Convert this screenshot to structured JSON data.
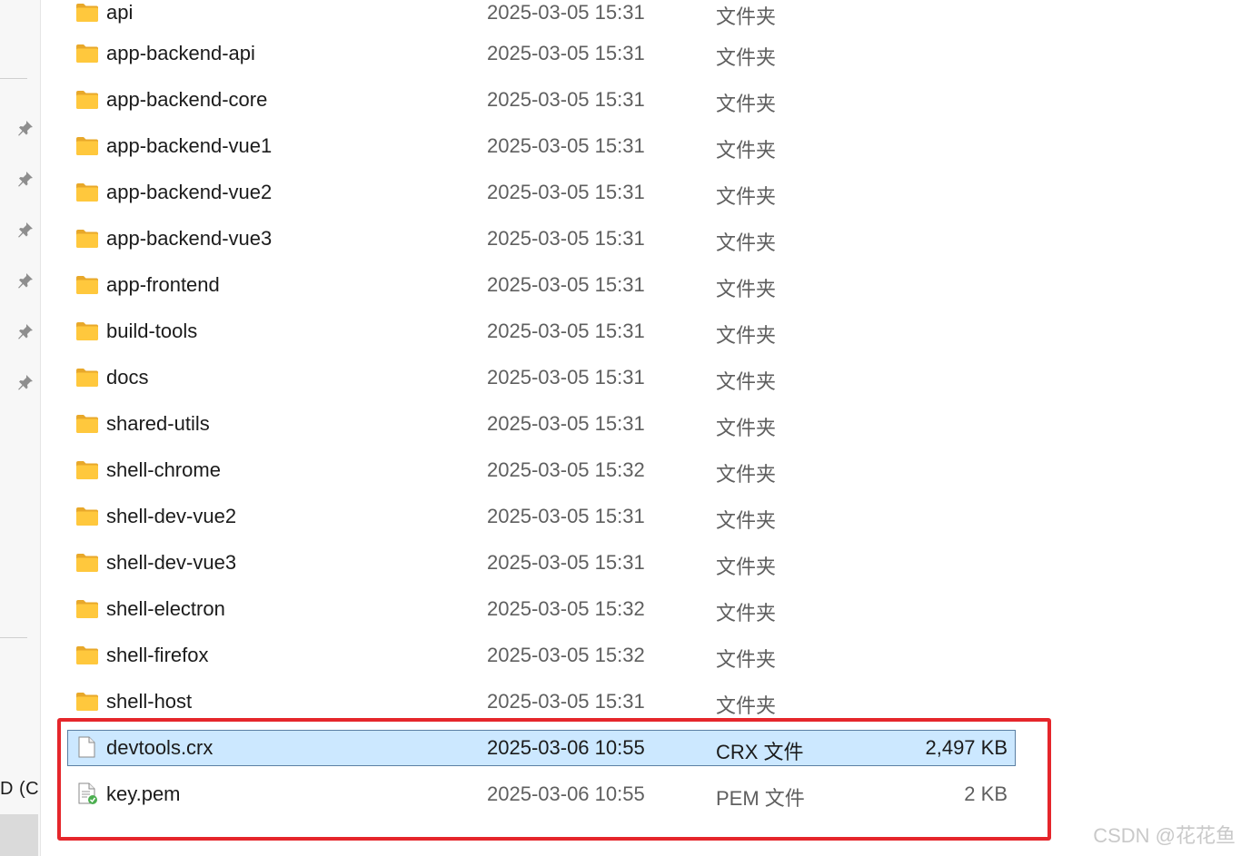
{
  "nav": {
    "partial_text": "D (C",
    "pin_count": 6
  },
  "files": [
    {
      "name": "api",
      "date": "2025-03-05 15:31",
      "type": "文件夹",
      "size": "",
      "icon": "folder-icon"
    },
    {
      "name": "app-backend-api",
      "date": "2025-03-05 15:31",
      "type": "文件夹",
      "size": "",
      "icon": "folder-icon"
    },
    {
      "name": "app-backend-core",
      "date": "2025-03-05 15:31",
      "type": "文件夹",
      "size": "",
      "icon": "folder-icon"
    },
    {
      "name": "app-backend-vue1",
      "date": "2025-03-05 15:31",
      "type": "文件夹",
      "size": "",
      "icon": "folder-icon"
    },
    {
      "name": "app-backend-vue2",
      "date": "2025-03-05 15:31",
      "type": "文件夹",
      "size": "",
      "icon": "folder-icon"
    },
    {
      "name": "app-backend-vue3",
      "date": "2025-03-05 15:31",
      "type": "文件夹",
      "size": "",
      "icon": "folder-icon"
    },
    {
      "name": "app-frontend",
      "date": "2025-03-05 15:31",
      "type": "文件夹",
      "size": "",
      "icon": "folder-icon"
    },
    {
      "name": "build-tools",
      "date": "2025-03-05 15:31",
      "type": "文件夹",
      "size": "",
      "icon": "folder-icon"
    },
    {
      "name": "docs",
      "date": "2025-03-05 15:31",
      "type": "文件夹",
      "size": "",
      "icon": "folder-icon"
    },
    {
      "name": "shared-utils",
      "date": "2025-03-05 15:31",
      "type": "文件夹",
      "size": "",
      "icon": "folder-icon"
    },
    {
      "name": "shell-chrome",
      "date": "2025-03-05 15:32",
      "type": "文件夹",
      "size": "",
      "icon": "folder-icon"
    },
    {
      "name": "shell-dev-vue2",
      "date": "2025-03-05 15:31",
      "type": "文件夹",
      "size": "",
      "icon": "folder-icon"
    },
    {
      "name": "shell-dev-vue3",
      "date": "2025-03-05 15:31",
      "type": "文件夹",
      "size": "",
      "icon": "folder-icon"
    },
    {
      "name": "shell-electron",
      "date": "2025-03-05 15:32",
      "type": "文件夹",
      "size": "",
      "icon": "folder-icon"
    },
    {
      "name": "shell-firefox",
      "date": "2025-03-05 15:32",
      "type": "文件夹",
      "size": "",
      "icon": "folder-icon"
    },
    {
      "name": "shell-host",
      "date": "2025-03-05 15:31",
      "type": "文件夹",
      "size": "",
      "icon": "folder-icon"
    },
    {
      "name": "devtools.crx",
      "date": "2025-03-06 10:55",
      "type": "CRX 文件",
      "size": "2,497 KB",
      "icon": "file-icon",
      "selected": true
    },
    {
      "name": "key.pem",
      "date": "2025-03-06 10:55",
      "type": "PEM 文件",
      "size": "2 KB",
      "icon": "certificate-file-icon"
    }
  ],
  "colors": {
    "selection_bg": "#cce8ff",
    "selection_border": "#5b7fa3",
    "highlight_border": "#e5262b",
    "folder_yellow": "#ffc83d"
  },
  "watermark": "CSDN @花花鱼"
}
